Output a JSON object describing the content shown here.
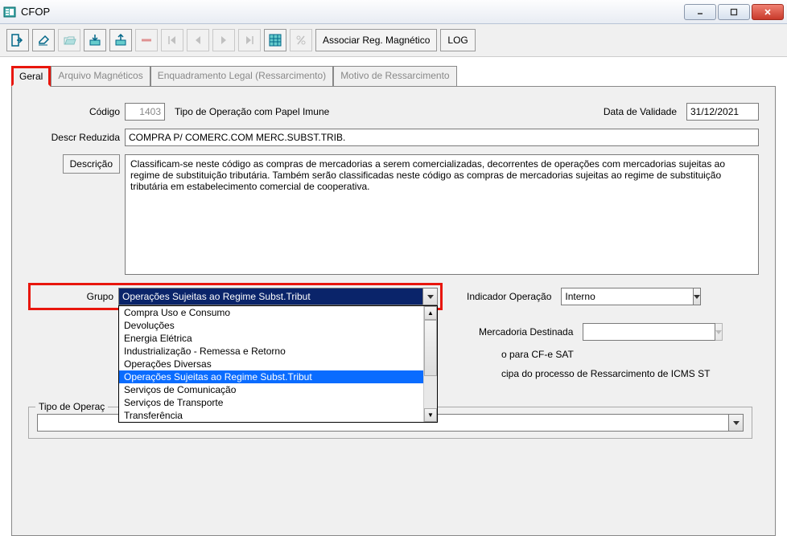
{
  "window": {
    "title": "CFOP"
  },
  "toolbar": {
    "assoc_label": "Associar Reg. Magnético",
    "log_label": "LOG"
  },
  "tabs": [
    {
      "label": "Geral",
      "active": true
    },
    {
      "label": "Arquivo Magnéticos",
      "active": false
    },
    {
      "label": "Enquadramento Legal (Ressarcimento)",
      "active": false
    },
    {
      "label": "Motivo de Ressarcimento",
      "active": false
    }
  ],
  "geral": {
    "codigo_label": "Código",
    "codigo_value": "1403",
    "tipo_op_text": "Tipo de Operação com Papel Imune",
    "data_validade_label": "Data de Validade",
    "data_validade_value": "31/12/2021",
    "descr_red_label": "Descr Reduzida",
    "descr_red_value": "COMPRA P/ COMERC.COM MERC.SUBST.TRIB.",
    "descricao_btn": "Descrição",
    "descricao_text": "Classificam-se neste código as compras de mercadorias a serem comercializadas, decorrentes de operações com mercadorias sujeitas ao regime de substituição tributária. Também serão classificadas neste código as compras de mercadorias sujeitas ao regime de substituição tributária em estabelecimento comercial de cooperativa.",
    "grupo_label": "Grupo",
    "grupo_value": "Operações Sujeitas ao Regime Subst.Tribut",
    "grupo_options": [
      "Compra Uso e Consumo",
      "Devoluções",
      "Energia Elétrica",
      "Industrialização - Remessa e Retorno",
      "Operações Diversas",
      "Operações Sujeitas ao Regime Subst.Tribut",
      "Serviços de Comunicação",
      "Serviços de Transporte",
      "Transferência"
    ],
    "grupo_selected_index": 5,
    "indicador_op_label": "Indicador Operação",
    "indicador_op_value": "Interno",
    "mercadoria_label": "Mercadoria Destinada",
    "mercadoria_value": "",
    "cf_sat_text": "o para CF-e SAT",
    "ressarc_text": "cipa do processo de Ressarcimento de ICMS ST",
    "tipo_op_legend": "Tipo de Operaç"
  }
}
